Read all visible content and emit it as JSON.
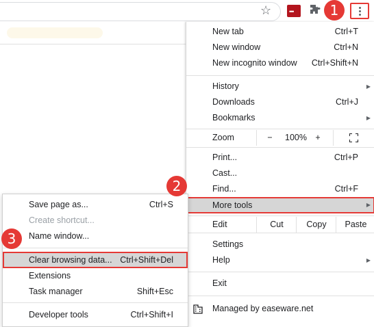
{
  "menu": {
    "new_tab": {
      "label": "New tab",
      "shortcut": "Ctrl+T"
    },
    "new_window": {
      "label": "New window",
      "shortcut": "Ctrl+N"
    },
    "new_incognito": {
      "label": "New incognito window",
      "shortcut": "Ctrl+Shift+N"
    },
    "history": {
      "label": "History"
    },
    "downloads": {
      "label": "Downloads",
      "shortcut": "Ctrl+J"
    },
    "bookmarks": {
      "label": "Bookmarks"
    },
    "zoom": {
      "label": "Zoom",
      "minus": "−",
      "value": "100%",
      "plus": "+"
    },
    "print": {
      "label": "Print...",
      "shortcut": "Ctrl+P"
    },
    "cast": {
      "label": "Cast..."
    },
    "find": {
      "label": "Find...",
      "shortcut": "Ctrl+F"
    },
    "more_tools": {
      "label": "More tools"
    },
    "edit": {
      "label": "Edit",
      "cut": "Cut",
      "copy": "Copy",
      "paste": "Paste"
    },
    "settings": {
      "label": "Settings"
    },
    "help": {
      "label": "Help"
    },
    "exit": {
      "label": "Exit"
    },
    "managed": {
      "label": "Managed by easeware.net"
    }
  },
  "submenu": {
    "save_page": {
      "label": "Save page as...",
      "shortcut": "Ctrl+S"
    },
    "create_shortcut": {
      "label": "Create shortcut..."
    },
    "name_window": {
      "label": "Name window..."
    },
    "clear_browsing": {
      "label": "Clear browsing data...",
      "shortcut": "Ctrl+Shift+Del"
    },
    "extensions": {
      "label": "Extensions"
    },
    "task_manager": {
      "label": "Task manager",
      "shortcut": "Shift+Esc"
    },
    "developer_tools": {
      "label": "Developer tools",
      "shortcut": "Ctrl+Shift+I"
    }
  },
  "steps": {
    "one": "1",
    "two": "2",
    "three": "3"
  },
  "icons": {
    "bookmark": "star-icon",
    "extension": "puzzle-icon",
    "menu": "kebab-icon",
    "managed": "building-icon"
  },
  "colors": {
    "highlight": "#e53935",
    "hover": "#d6d6d6"
  }
}
